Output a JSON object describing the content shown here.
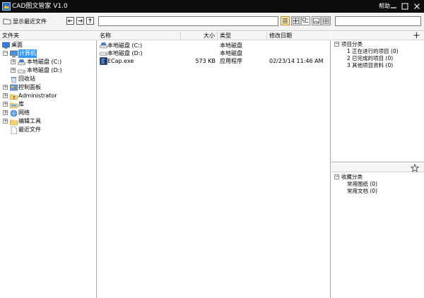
{
  "app": {
    "title": "CAD图文管家 V1.0",
    "help_label": "帮助"
  },
  "toolbar": {
    "recent_label": "显示最近文件",
    "path_value": "",
    "search_value": ""
  },
  "left_panel": {
    "header": "文件夹",
    "tree": [
      {
        "label": "桌面",
        "icon": "desktop-icon",
        "expander": ""
      },
      {
        "label": "计算机",
        "icon": "computer-icon",
        "expander": "−",
        "selected": true
      },
      {
        "label": "本地磁盘 (C:)",
        "icon": "drive-icon",
        "expander": "+"
      },
      {
        "label": "本地磁盘 (D:)",
        "icon": "drive-icon",
        "expander": "+"
      },
      {
        "label": "回收站",
        "icon": "recycle-bin-icon",
        "expander": ""
      },
      {
        "label": "控制面板",
        "icon": "control-panel-icon",
        "expander": "+"
      },
      {
        "label": "Administrator",
        "icon": "user-folder-icon",
        "expander": "+"
      },
      {
        "label": "库",
        "icon": "library-icon",
        "expander": "+"
      },
      {
        "label": "网络",
        "icon": "network-icon",
        "expander": "+"
      },
      {
        "label": "编辑工具",
        "icon": "folder-icon",
        "expander": "+"
      },
      {
        "label": "最近文件",
        "icon": "document-icon",
        "expander": ""
      }
    ]
  },
  "center_panel": {
    "columns": {
      "name": "名称",
      "size": "大小",
      "type": "类型",
      "modified": "修改日期"
    },
    "files": [
      {
        "name": "本地磁盘 (C:)",
        "size": "",
        "type": "本地磁盘",
        "modified": "",
        "icon": "drive-icon"
      },
      {
        "name": "本地磁盘 (D:)",
        "size": "",
        "type": "本地磁盘",
        "modified": "",
        "icon": "drive-icon"
      },
      {
        "name": "ECap.exe",
        "size": "573 KB",
        "type": "应用程序",
        "modified": "02/23/14 11:46 AM",
        "icon": "exe-icon"
      }
    ]
  },
  "right_panel": {
    "project": {
      "title": "项目分类",
      "items": [
        {
          "label": "1 正在进行的项目 (0)"
        },
        {
          "label": "2 已完成的项目 (0)"
        },
        {
          "label": "3 其他项目资料 (0)"
        }
      ]
    },
    "favorites": {
      "title": "收藏分类",
      "items": [
        {
          "label": "常用图纸 (0)"
        },
        {
          "label": "常用文档 (0)"
        }
      ]
    }
  },
  "colors": {
    "titlebar": "#0d0d0d",
    "selection": "#3399ff",
    "active_view": "#ffe9a8"
  }
}
